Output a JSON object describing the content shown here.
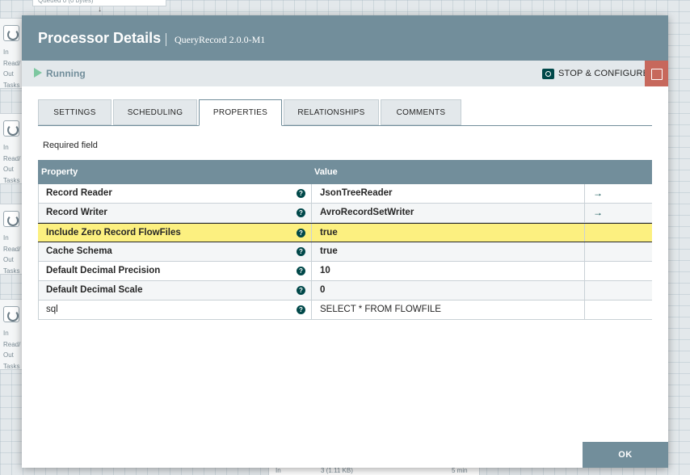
{
  "background": {
    "queued_text": "Queued 0 (0 bytes)",
    "processor_stats": [
      "In",
      "Read/",
      "Out",
      "Tasks"
    ],
    "bottom_in": "In",
    "bottom_count": "3 (1.11 KB)",
    "bottom_time": "5 min"
  },
  "dialog": {
    "title": "Processor Details",
    "subtitle": "QueryRecord 2.0.0-M1",
    "status": "Running",
    "stop_configure_label": "STOP & CONFIGURE",
    "tabs": [
      "SETTINGS",
      "SCHEDULING",
      "PROPERTIES",
      "RELATIONSHIPS",
      "COMMENTS"
    ],
    "active_tab": "PROPERTIES",
    "required_field_label": "Required field",
    "table": {
      "headers": {
        "property": "Property",
        "value": "Value"
      },
      "rows": [
        {
          "name": "Record Reader",
          "value": "JsonTreeReader",
          "required": true,
          "has_goto": true
        },
        {
          "name": "Record Writer",
          "value": "AvroRecordSetWriter",
          "required": true,
          "has_goto": true
        },
        {
          "name": "Include Zero Record FlowFiles",
          "value": "true",
          "required": true,
          "has_goto": false
        },
        {
          "name": "Cache Schema",
          "value": "true",
          "required": true,
          "has_goto": false
        },
        {
          "name": "Default Decimal Precision",
          "value": "10",
          "required": true,
          "has_goto": false
        },
        {
          "name": "Default Decimal Scale",
          "value": "0",
          "required": true,
          "has_goto": false
        },
        {
          "name": "sql",
          "value": "SELECT * FROM FLOWFILE",
          "required": false,
          "has_goto": false
        }
      ],
      "help_glyph": "?",
      "goto_glyph": "→"
    },
    "ok_label": "OK"
  },
  "colors": {
    "header": "#728e9b",
    "running": "#7dc7a0",
    "highlight_row": "#fcf080",
    "sticky_button": "#c7685c",
    "icon_dark": "#004849"
  }
}
